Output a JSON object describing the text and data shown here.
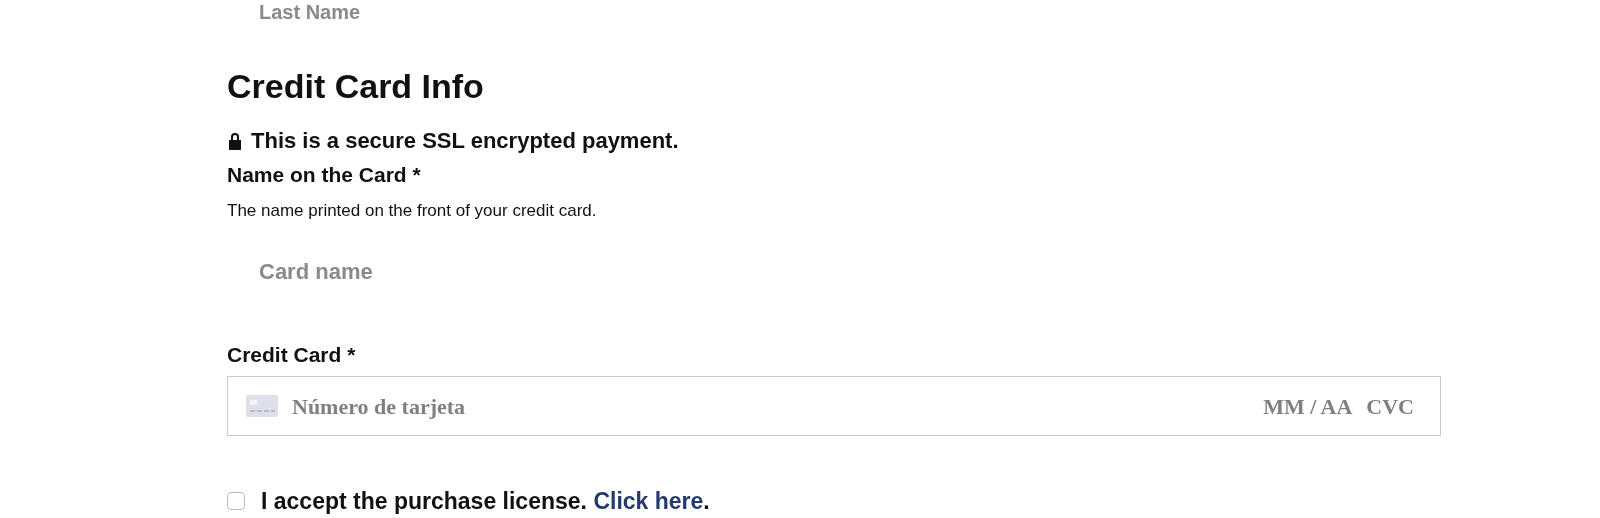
{
  "last_name": {
    "placeholder": "Last Name"
  },
  "section_title": "Credit Card Info",
  "secure_note": "This is a secure SSL encrypted payment.",
  "card_name": {
    "label": "Name on the Card *",
    "help": "The name printed on the front of your credit card.",
    "placeholder": "Card name"
  },
  "credit_card": {
    "label": "Credit Card *",
    "number_placeholder": "Número de tarjeta",
    "expiry_placeholder": "MM / AA",
    "cvc_placeholder": "CVC"
  },
  "license": {
    "checked": false,
    "text": "I accept the purchase license.",
    "link": "Click here",
    "end": "."
  }
}
